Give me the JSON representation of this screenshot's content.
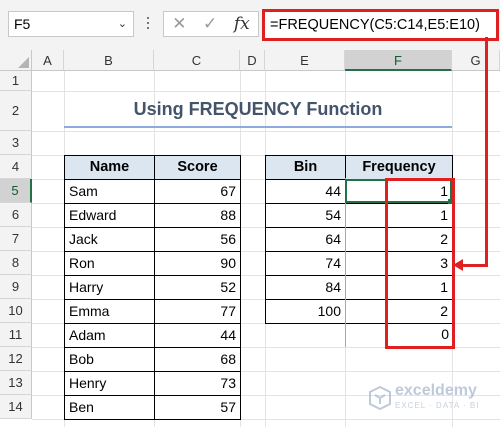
{
  "namebox": {
    "value": "F5",
    "arrow": "chevron-down-icon"
  },
  "formula_bar": {
    "cancel_icon": "✕",
    "enter_icon": "✓",
    "fx_label": "fx",
    "formula": "=FREQUENCY(C5:C14,E5:E10)"
  },
  "columns": [
    "A",
    "B",
    "C",
    "D",
    "E",
    "F",
    "G"
  ],
  "rows": [
    "1",
    "2",
    "3",
    "4",
    "5",
    "6",
    "7",
    "8",
    "9",
    "10",
    "11",
    "12",
    "13",
    "14"
  ],
  "title": "Using FREQUENCY Function",
  "score_table": {
    "headers": [
      "Name",
      "Score"
    ],
    "rows": [
      {
        "name": "Sam",
        "score": "67"
      },
      {
        "name": "Edward",
        "score": "88"
      },
      {
        "name": "Jack",
        "score": "56"
      },
      {
        "name": "Ron",
        "score": "90"
      },
      {
        "name": "Harry",
        "score": "52"
      },
      {
        "name": "Emma",
        "score": "77"
      },
      {
        "name": "Adam",
        "score": "44"
      },
      {
        "name": "Bob",
        "score": "68"
      },
      {
        "name": "Henry",
        "score": "73"
      },
      {
        "name": "Ben",
        "score": "57"
      }
    ]
  },
  "freq_table": {
    "headers": [
      "Bin",
      "Frequency"
    ],
    "bins": [
      "44",
      "54",
      "64",
      "74",
      "84",
      "100"
    ],
    "frequencies": [
      "1",
      "1",
      "2",
      "3",
      "1",
      "2",
      "0"
    ]
  },
  "watermark": {
    "name": "exceldemy",
    "tagline": "EXCEL · DATA · BI"
  },
  "colors": {
    "accent_red": "#e02020",
    "excel_green": "#217346",
    "header_fill": "#dce6f1"
  }
}
